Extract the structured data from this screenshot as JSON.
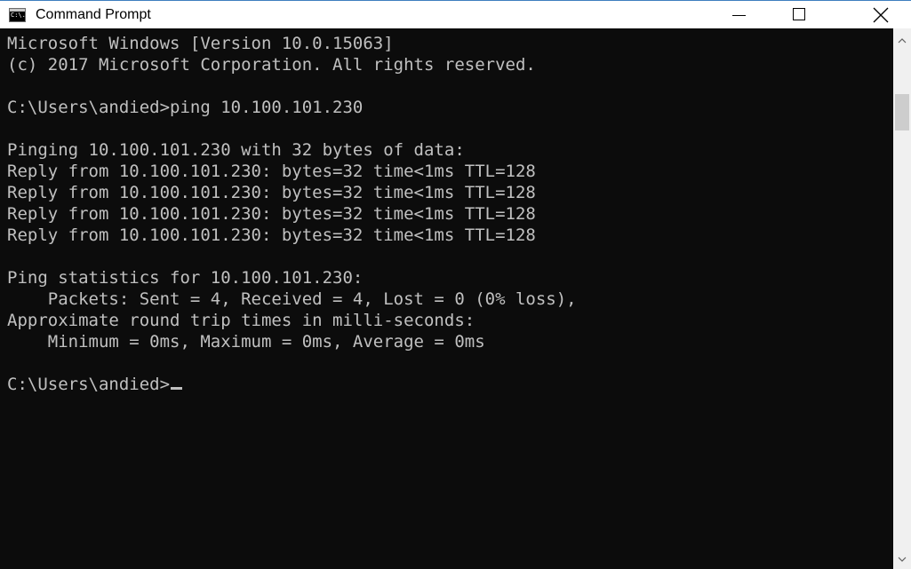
{
  "window": {
    "title": "Command Prompt",
    "icon_text": "C:\\."
  },
  "icons": {
    "app": "cmd-app-icon",
    "minimize": "minimize-icon",
    "maximize": "maximize-icon",
    "close": "close-icon",
    "scroll_up": "chevron-up-icon",
    "scroll_down": "chevron-down-icon"
  },
  "colors": {
    "console_background": "#0c0c0c",
    "console_text": "#c0c0c0",
    "titlebar_background": "#ffffff",
    "window_border": "#3f7fbf"
  },
  "console": {
    "lines": [
      "Microsoft Windows [Version 10.0.15063]",
      "(c) 2017 Microsoft Corporation. All rights reserved.",
      "",
      "C:\\Users\\andied>ping 10.100.101.230",
      "",
      "Pinging 10.100.101.230 with 32 bytes of data:",
      "Reply from 10.100.101.230: bytes=32 time<1ms TTL=128",
      "Reply from 10.100.101.230: bytes=32 time<1ms TTL=128",
      "Reply from 10.100.101.230: bytes=32 time<1ms TTL=128",
      "Reply from 10.100.101.230: bytes=32 time<1ms TTL=128",
      "",
      "Ping statistics for 10.100.101.230:",
      "    Packets: Sent = 4, Received = 4, Lost = 0 (0% loss),",
      "Approximate round trip times in milli-seconds:",
      "    Minimum = 0ms, Maximum = 0ms, Average = 0ms",
      "",
      "C:\\Users\\andied>"
    ]
  }
}
